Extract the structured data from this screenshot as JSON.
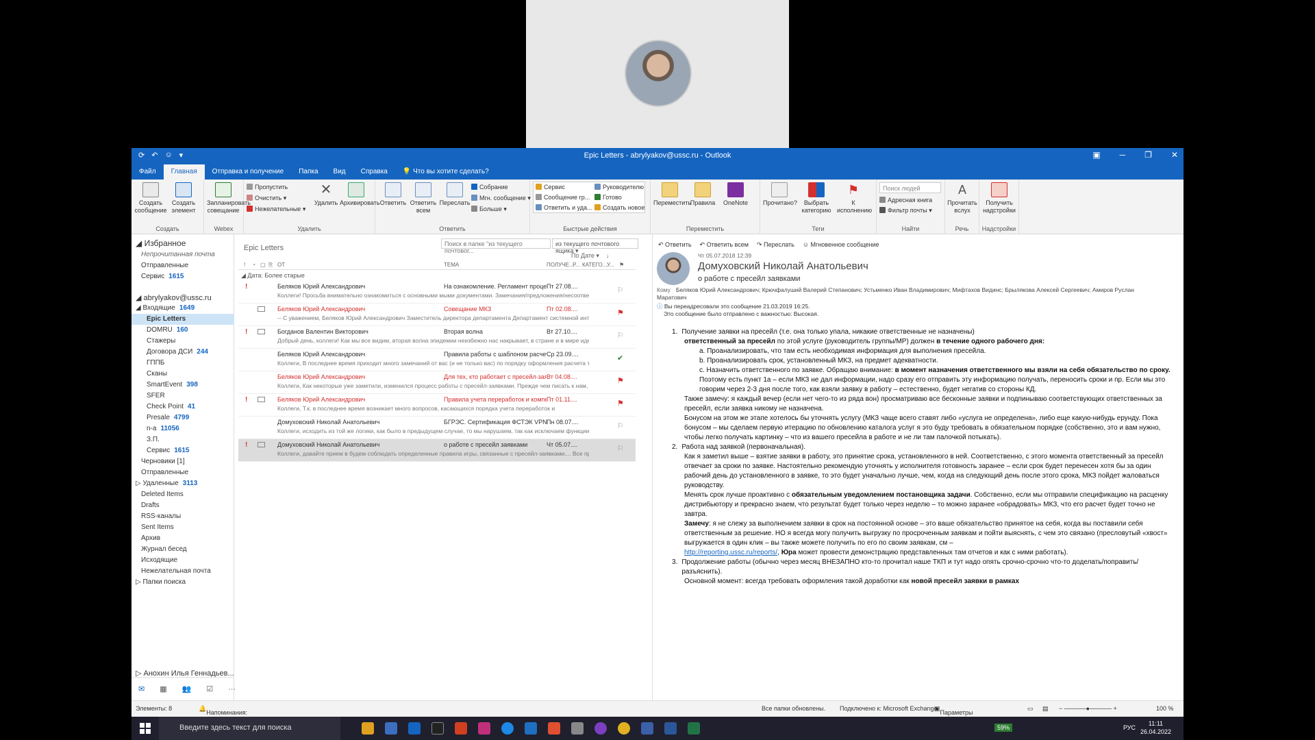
{
  "window": {
    "title": "Epic Letters - abrylyakov@ussc.ru  -  Outlook"
  },
  "menu": [
    "Файл",
    "Главная",
    "Отправка и получение",
    "Папка",
    "Вид",
    "Справка",
    "Что вы хотите сделать?"
  ],
  "ribbon": {
    "create_mail": "Создать сообщение",
    "create_item": "Создать элемент",
    "group_create": "Создать",
    "schedule": "Запланировать совещание",
    "group_webex": "Webex",
    "ignore": "Пропустить",
    "clean": "Очистить",
    "junk": "Нежелательные",
    "delete": "Удалить",
    "archive": "Архивировать",
    "group_delete": "Удалить",
    "reply": "Ответить",
    "reply_all": "Ответить всем",
    "forward": "Переслать",
    "meeting": "Собрание",
    "im": "Мгн. сообщение",
    "more": "Больше",
    "group_respond": "Ответить",
    "qs_service": "Сервис",
    "qs_manager": "Руководителю",
    "qs_msg_group": "Сообщение гр...",
    "qs_done": "Готово",
    "qs_reply_delete": "Ответить и уда...",
    "qs_new": "Создать новое",
    "group_quick": "Быстрые действия",
    "move": "Переместить",
    "rules": "Правила",
    "onenote": "OneNote",
    "group_move": "Переместить",
    "read": "Прочитано?",
    "categorize": "Выбрать категорию",
    "followup": "К исполнению",
    "group_tags": "Теги",
    "search_people": "Поиск людей",
    "address_book": "Адресная книга",
    "filter_mail": "Фильтр почты",
    "group_find": "Найти",
    "read_aloud": "Прочитать вслух",
    "group_speech": "Речь",
    "get_addins": "Получить надстройки",
    "group_addins": "Надстройки"
  },
  "nav": {
    "favorites": "Избранное",
    "fav_items": [
      {
        "label": "Непрочитанная почта",
        "count": ""
      },
      {
        "label": "Отправленные",
        "count": ""
      },
      {
        "label": "Сервис",
        "count": "1615"
      }
    ],
    "account": "abrylyakov@ussc.ru",
    "inbox": {
      "label": "Входящие",
      "count": "1649"
    },
    "folders": [
      {
        "label": "Epic Letters",
        "count": ""
      },
      {
        "label": "DOMRU",
        "count": "160"
      },
      {
        "label": "Стажеры",
        "count": ""
      },
      {
        "label": "Договора ДСИ",
        "count": "244"
      },
      {
        "label": "ГППБ",
        "count": ""
      },
      {
        "label": "Сканы",
        "count": ""
      },
      {
        "label": "SmartEvent",
        "count": "398"
      },
      {
        "label": "SFER",
        "count": ""
      },
      {
        "label": "Check Point",
        "count": "41"
      },
      {
        "label": "Presale",
        "count": "4799"
      },
      {
        "label": "n-a",
        "count": "11056"
      },
      {
        "label": "З.П.",
        "count": ""
      },
      {
        "label": "Сервис",
        "count": "1615"
      }
    ],
    "root_folders": [
      {
        "label": "Черновики [1]",
        "count": ""
      },
      {
        "label": "Отправленные",
        "count": ""
      },
      {
        "label": "Удаленные",
        "count": "3113"
      },
      {
        "label": "Deleted Items",
        "count": ""
      },
      {
        "label": "Drafts",
        "count": ""
      },
      {
        "label": "RSS-каналы",
        "count": ""
      },
      {
        "label": "Sent Items",
        "count": ""
      },
      {
        "label": "Архив",
        "count": ""
      },
      {
        "label": "Журнал бесед",
        "count": ""
      },
      {
        "label": "Исходящие",
        "count": ""
      },
      {
        "label": "Нежелательная почта",
        "count": ""
      },
      {
        "label": "Папки поиска",
        "count": ""
      }
    ],
    "other_account": "Анохин Илья Геннадьев...",
    "bottom_icons": [
      "mail-icon",
      "calendar-icon",
      "people-icon",
      "tasks-icon",
      "more-icon"
    ]
  },
  "list": {
    "title": "Epic Letters",
    "search_placeholder": "Поиск в папке \"из текущего почтовог...",
    "scope": "из текущего почтового ящика",
    "sort": "По Дате",
    "columns": {
      "from": "ОТ",
      "subject": "ТЕМА",
      "received": "ПОЛУЧЕ...",
      "size": "Р...",
      "category": "КАТЕГО...",
      "mention": "У..."
    },
    "group_header": "Дата: Более старые",
    "messages": [
      {
        "from": "Беляков Юрий Александрович",
        "subject": "На ознакомление. Регламент процесса ...",
        "date": "Пт 27.08....",
        "preview": "Коллеги!  Просьба внимательно ознакомиться с основными мыми документами.  Замечания/предложения/несоответствия –",
        "important": true,
        "red": false,
        "flag": "outline"
      },
      {
        "from": "Беляков Юрий Александрович",
        "subject": "Совещание МКЗ",
        "date": "Пт 02.08....",
        "preview": "-- С уважением, Беляков Юрий Александрович Заместитель директора департамента  Департамент системной интеграции",
        "important": false,
        "red": true,
        "flag": "red"
      },
      {
        "from": "Богданов Валентин Викторович",
        "subject": "Вторая волна",
        "date": "Вт 27.10....",
        "preview": "Добрый день, коллеги!  Как мы все видим, вторая волна эпидемии неизбежно нас накрывает, в стране и в мире идет рост",
        "important": true,
        "red": false,
        "flag": "outline"
      },
      {
        "from": "Беляков Юрий Александрович",
        "subject": "Правила работы с шаблоном расчета т...",
        "date": "Ср 23.09....",
        "preview": "Коллеги,  В последнее время приходит много замечаний от вас (и не только вас) по порядку оформления расчета трудозатрат и работы с",
        "important": false,
        "red": false,
        "flag": "done"
      },
      {
        "from": "Беляков Юрий Александрович",
        "subject": "Для тех, кто работает с пресейл-заявка...",
        "date": "Вт 04.08....",
        "preview": "Коллеги,  Как некоторые уже заметили, изменился процесс работы с пресейл-заявками.  Прежде чем писать к нам,",
        "important": false,
        "red": true,
        "flag": "red"
      },
      {
        "from": "Беляков Юрий Александрович",
        "subject": "Правила учета переработок и компенс...",
        "date": "Пт 01.11....",
        "preview": "Коллеги,  Т.к. в последнее время возникает много вопросов, касающихся порядка учета переработок и",
        "important": true,
        "red": true,
        "flag": "red"
      },
      {
        "from": "Домуховский Николай Анатольевич",
        "subject": "БГРЭС. Сертификация ФСТЭК VPN",
        "date": "Пн 08.07....",
        "preview": "Коллеги, исходить из той же логики, как было в предыдущем случае, то мы нарушаем, так как исключаем функции, не прощаемые",
        "important": false,
        "red": false,
        "flag": "outline"
      },
      {
        "from": "Домуховский Николай Анатольевич",
        "subject": "о работе с пресейл заявками",
        "date": "Чт 05.07....",
        "preview": "Коллеги, давайте прием в будем соблюдать определенные правила игры, связанные с пресейл-заявками.... Все пресейл",
        "important": true,
        "red": false,
        "flag": "outline",
        "selected": true
      }
    ]
  },
  "reading": {
    "actions": [
      "Ответить",
      "Ответить всем",
      "Переслать",
      "Мгновенное сообщение"
    ],
    "date": "Чт 05.07.2018 12:39",
    "sender": "Домуховский Николай Анатольевич",
    "subject": "о работе с пресейл заявками",
    "to_label": "Кому",
    "recipients": "Беляков Юрий Александрович; Крючфалуший Валерий Степанович; Устьменко Иван Владимирович; Мифтахов Видинс; Брылякова Алексей Сергеевич; Амиров Руслан Маратович",
    "info1": "Вы переадресовали это сообщение 21.03.2019 16:25.",
    "info2": "Это сообщение было отправлено с важностью: Высокая.",
    "p1_num": "1.",
    "p1_intro": "Получение заявки на пресейл (т.е. она только упала, никакие ответственные не назначены)",
    "p1_bold_a": "ответственный за пресейл",
    "p1_mid": " по этой услуге (руководитель группы/МР) должен ",
    "p1_bold_b": "в течение одного рабочего дня:",
    "p1_a": "a.   Проанализировать, что там есть необходимая информация для выполнения пресейла.",
    "p1_b": "b.   Проанализировать срок, установленный МКЗ, на предмет адекватности.",
    "p1_c_pre": "c.   Назначить ответственного по заявке. Обращаю внимание: ",
    "p1_c_bold": "в момент назначения ответственного мы взяли на себя обязательство по сроку.",
    "p1_c_post": " Поэтому есть пункт 1a – если МКЗ не дал информации, надо сразу его отправить эту информацию получать, переносить сроки и пр. Если мы это говорим через 2-3 дня после того, как взяли заявку в работу – естественно, будет негатив со стороны КД.",
    "p1_extra1": "Также замечу: я каждый вечер (если нет чего-то из ряда вон) просматриваю все бесконные заявки и подпинываю соответствующих ответственных за пресейл, если заявка никому не назначена.",
    "p1_extra2": "Бонусом на этом же этапе хотелось бы уточнять услугу (МКЗ чаще всего ставят либо «услуга не определена», либо еще какую-нибудь ерунду. Пока бонусом – мы сделаем первую итерацию по обновлению каталога услуг я это буду требовать в обязательном порядке (собственно, это и вам нужно, чтобы легко получать картинку – что из вашего пресейла в работе и не ли там палочкой потыкать).",
    "p2_num": "2.",
    "p2_title": "Работа над заявкой (первоначальная).",
    "p2_text1": "Как я заметил выше – взятие заявки в работу, это принятие срока, установленного в ней. Соответственно, с этого момента ответственный за пресейл отвечает за сроки по заявке. Настоятельно рекомендую уточнять у исполнителя готовность заранее – если срок будет перенесен хотя бы за один рабочий день до установленного в заявке, то это будет уначально лучше, чем, когда на следующий день после этого срока, МКЗ пойдет жаловаться руководству.",
    "p2_text2_pre": "Менять срок лучше проактивно с ",
    "p2_text2_bold": "обязательным уведомлением постановщика задачи",
    "p2_text2_post": ". Собственно, если мы отправили спецификацию на расценку дистрибьютору и прекрасно знаем, что результат будет только через неделю – то можно заранее «обрадовать» МКЗ, что его расчет будет точно не завтра.",
    "p2_note_bold": "Замечу",
    "p2_note": ": я не слежу за выполнением заявки в срок на постоянной основе – это ваше обязательство принятое на себя, когда вы поставили себя ответственным за решение. НО я всегда могу получить выгрузку по просроченным заявкам и пойти выяснять, с чем это связано (пресловутый «хвост» выгружается в один клик – вы также можете получить по его по своим заявкам, см –",
    "p2_link": "http://reporting.ussc.ru/reports/",
    "p2_link_post_pre": ", ",
    "p2_link_bold": "Юра",
    "p2_link_post": " может провести демонстрацию представленных там отчетов и как с ними работать).",
    "p3_num": "3.",
    "p3_text": "Продолжение работы (обычно через месяц ВНЕЗАПНО кто-то прочитал наше ТКП и тут надо опять срочно-срочно что-то доделать/поправить/разъяснить).",
    "p3_main_pre": "Основной момент: всегда требовать оформления такой доработки как ",
    "p3_main_bold": "новой пресейл заявки в рамках"
  },
  "status": {
    "items": "Элементы: 8",
    "reminders": "Напоминания: 3",
    "all_updated": "Все папки обновлены.",
    "connected": "Подключено к: Microsoft Exchange",
    "display": "Параметры отображения",
    "zoom": "100 %"
  },
  "taskbar": {
    "search": "Введите здесь текст для поиска",
    "battery": "59%",
    "lang": "РУС",
    "time": "11:11",
    "date": "26.04.2022"
  },
  "colors": {
    "accent": "#1565c0",
    "flag_red": "#d32f2f",
    "done_green": "#2e7d32"
  }
}
